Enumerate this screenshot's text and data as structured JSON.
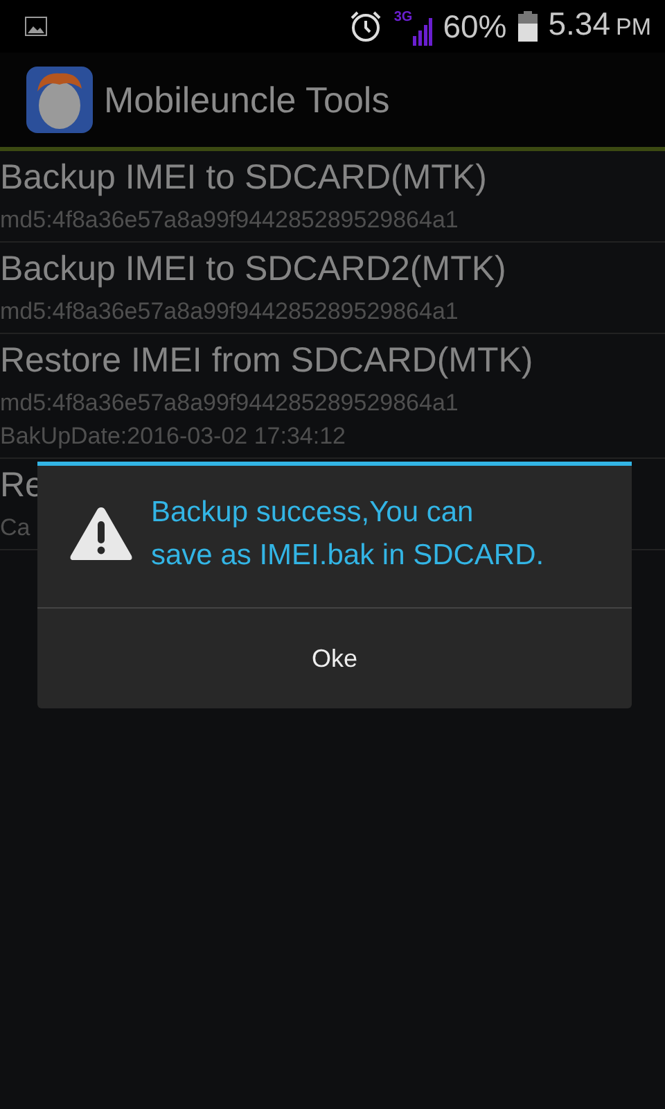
{
  "status_bar": {
    "battery": "60%",
    "network": "3G",
    "time": "5.34",
    "time_suffix": "PM"
  },
  "action_bar": {
    "title": "Mobileuncle Tools"
  },
  "items": [
    {
      "title": "Backup IMEI to SDCARD(MTK)",
      "lines": [
        "md5:4f8a36e57a8a99f944285289529864a1"
      ]
    },
    {
      "title": "Backup IMEI to SDCARD2(MTK)",
      "lines": [
        "md5:4f8a36e57a8a99f944285289529864a1"
      ]
    },
    {
      "title": "Restore IMEI from SDCARD(MTK)",
      "lines": [
        "md5:4f8a36e57a8a99f944285289529864a1",
        "BakUpDate:2016-03-02 17:34:12"
      ]
    },
    {
      "title": "Re",
      "lines": [
        "Ca"
      ]
    }
  ],
  "dialog": {
    "message_lines": [
      "Backup success,You can",
      "save as IMEI.bak in SDCARD."
    ],
    "buttons": [
      "Oke"
    ]
  }
}
